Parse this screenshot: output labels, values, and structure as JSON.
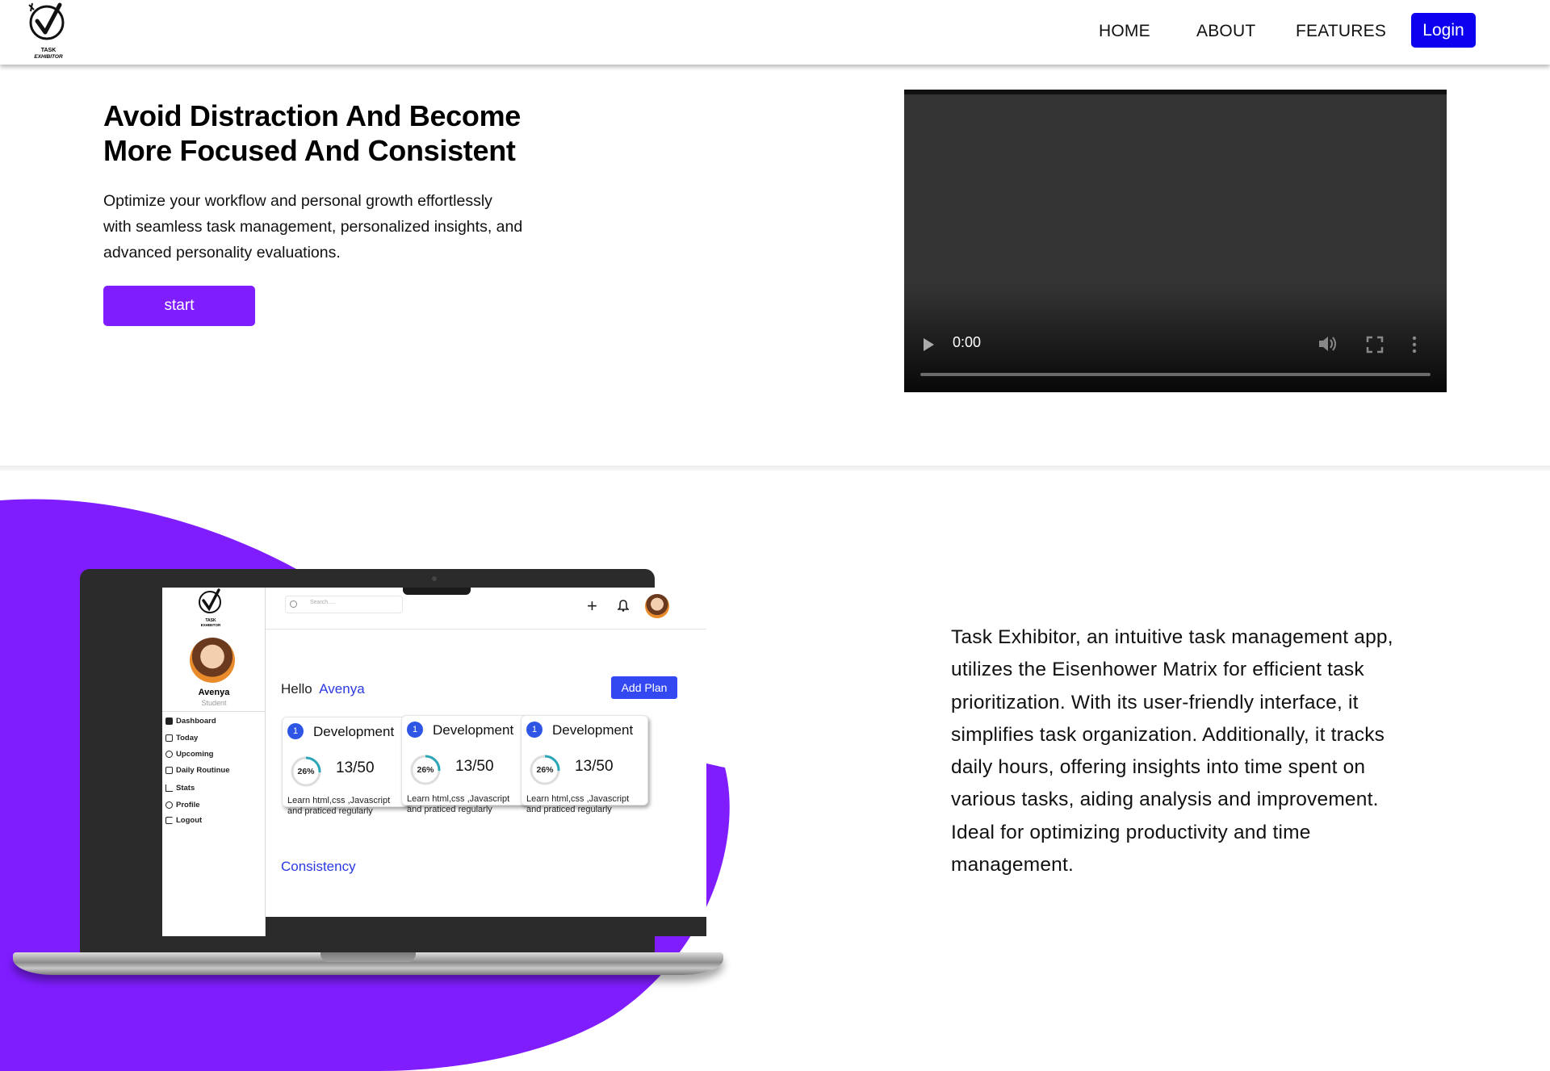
{
  "nav": {
    "logo_text": "TASK EXHIBITOR",
    "links": [
      "HOME",
      "ABOUT",
      "FEATURES"
    ],
    "login_label": "Login"
  },
  "hero": {
    "title_line1": "Avoid Distraction And Become",
    "title_line2": "More Focused And Consistent",
    "text_line1": "Optimize your workflow and personal growth effortlessly",
    "text_line2": "with seamless task management, personalized insights, and",
    "text_line3": "advanced personality evaluations.",
    "start_label": "start"
  },
  "video": {
    "time": "0:00",
    "progress": 0
  },
  "description": {
    "lines": [
      "Task Exhibitor, an intuitive task management app,",
      "utilizes the Eisenhower Matrix for efficient task",
      "prioritization. With its user-friendly interface, it",
      "simplifies task organization. Additionally, it tracks",
      "daily hours, offering insights into time spent on",
      "various tasks, aiding analysis and improvement.",
      "Ideal for optimizing productivity and time",
      "management."
    ]
  },
  "mockup": {
    "user_name": "Avenya",
    "user_role": "Student",
    "sidebar_items": [
      "Dashboard",
      "Today",
      "Upcoming",
      "Daily Routinue",
      "Stats",
      "Profile",
      "Logout"
    ],
    "search_placeholder": "Search.....",
    "greeting": "Hello",
    "greeting_name": "Avenya",
    "add_plan_label": "Add Plan",
    "cards": [
      {
        "num": "1",
        "title": "Development",
        "percent": "26%",
        "percent_value": 26,
        "score": "13/50",
        "desc_line1": "Learn html,css ,Javascript",
        "desc_line2": "and praticed regularly"
      },
      {
        "num": "1",
        "title": "Development",
        "percent": "26%",
        "percent_value": 26,
        "score": "13/50",
        "desc_line1": "Learn html,css ,Javascript",
        "desc_line2": "and praticed regularly"
      },
      {
        "num": "1",
        "title": "Development",
        "percent": "26%",
        "percent_value": 26,
        "score": "13/50",
        "desc_line1": "Learn html,css ,Javascript",
        "desc_line2": "and praticed regularly"
      }
    ],
    "section_label": "Consistency"
  },
  "colors": {
    "accent_purple": "#7f1dff",
    "login_blue": "#0d00ee",
    "app_blue": "#2b39e0"
  }
}
